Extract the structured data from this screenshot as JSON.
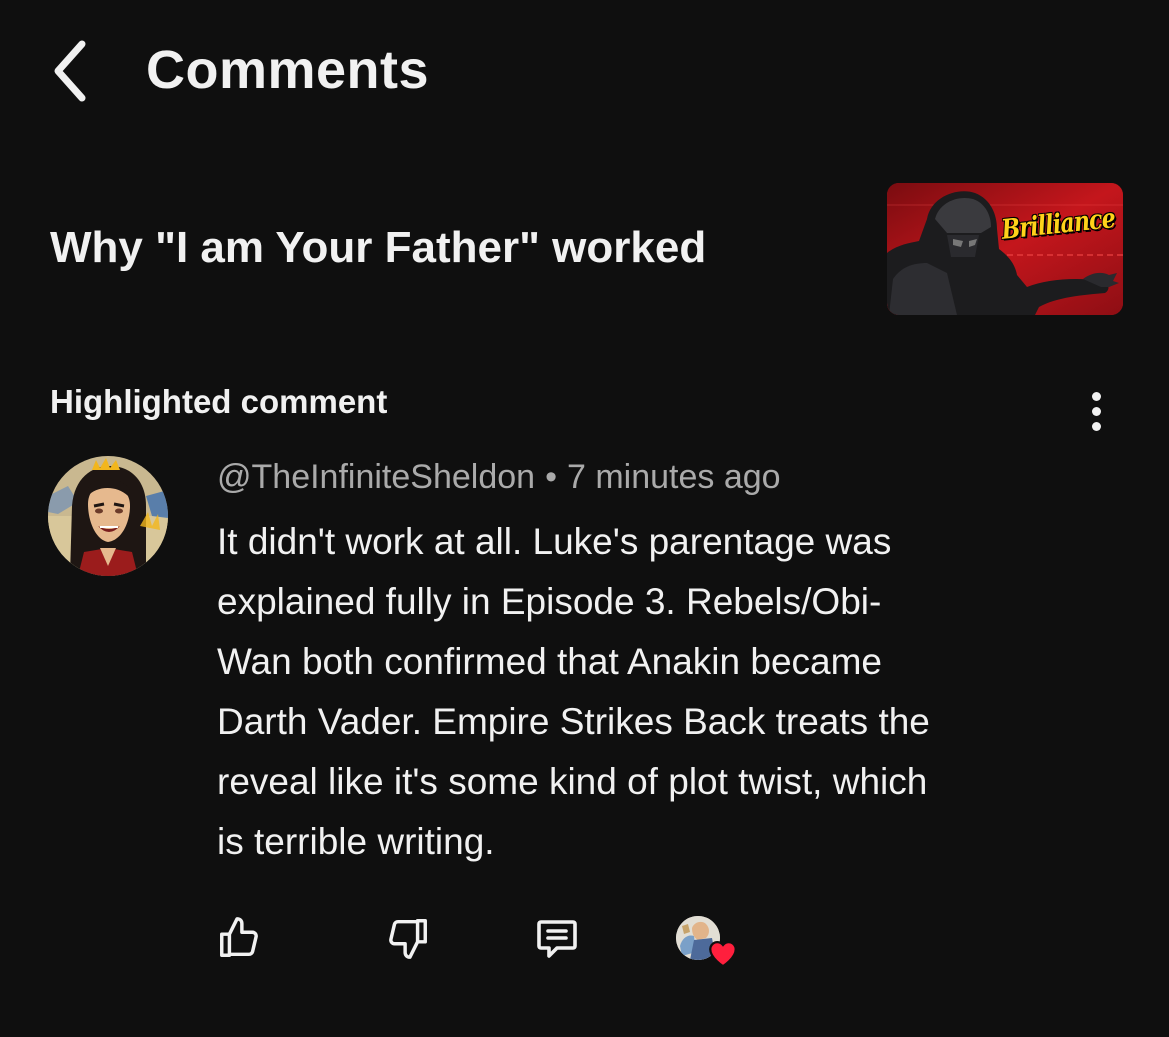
{
  "header": {
    "title": "Comments",
    "back_icon": "chevron-left-icon"
  },
  "video": {
    "title": "Why \"I am Your Father\" worked",
    "thumbnail_text": "Brilliance"
  },
  "highlight": {
    "label": "Highlighted comment",
    "more_icon": "vertical-dots-icon"
  },
  "comment": {
    "author": "@TheInfiniteSheldon",
    "separator": "•",
    "time": "7 minutes ago",
    "lines": [
      "It didn't work at all.  Luke's parentage was",
      "explained fully in Episode 3.  Rebels/Obi-",
      "Wan both confirmed that Anakin became",
      "Darth Vader.  Empire Strikes Back treats the",
      "reveal like it's some kind of plot twist, which",
      "is terrible writing."
    ]
  },
  "actions": {
    "like_icon": "thumbs-up-icon",
    "dislike_icon": "thumbs-down-icon",
    "reply_icon": "reply-comment-icon",
    "heart_icon": "heart-icon"
  },
  "colors": {
    "background": "#0f0f0f",
    "text": "#f1f1f1",
    "meta": "#aaaaaa",
    "heart": "#ff1f3d",
    "thumbnail_accent": "#b3121a"
  }
}
